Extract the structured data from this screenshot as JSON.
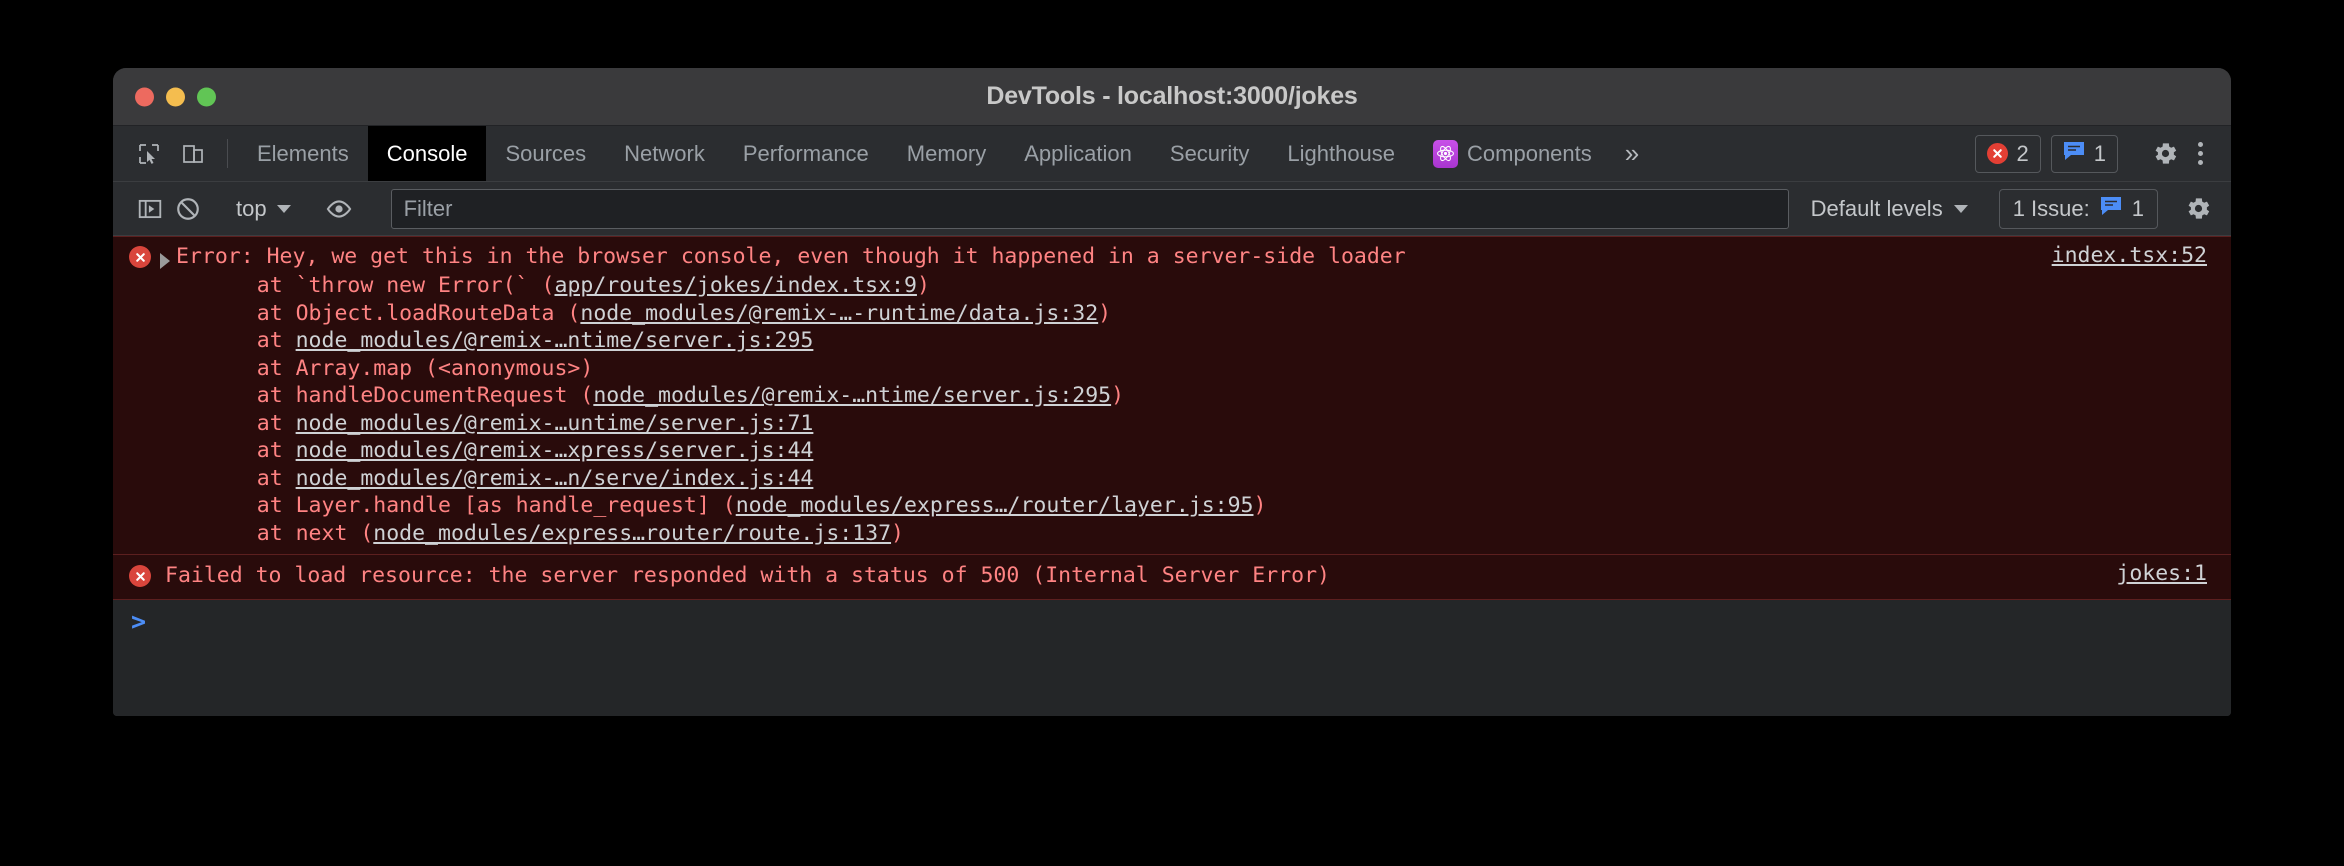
{
  "window": {
    "title": "DevTools - localhost:3000/jokes",
    "traffic_lights": [
      "close",
      "minimize",
      "maximize"
    ]
  },
  "tabbar": {
    "left_icons": [
      "inspect-element-icon",
      "device-toolbar-icon"
    ],
    "tabs": [
      {
        "label": "Elements",
        "active": false
      },
      {
        "label": "Console",
        "active": true
      },
      {
        "label": "Sources",
        "active": false
      },
      {
        "label": "Network",
        "active": false
      },
      {
        "label": "Performance",
        "active": false
      },
      {
        "label": "Memory",
        "active": false
      },
      {
        "label": "Application",
        "active": false
      },
      {
        "label": "Security",
        "active": false
      },
      {
        "label": "Lighthouse",
        "active": false
      },
      {
        "label": "Components",
        "active": false,
        "icon": "react-icon"
      }
    ],
    "more_tabs_label": "»",
    "error_badge": {
      "icon": "error-circle-icon",
      "count": "2"
    },
    "info_badge": {
      "icon": "message-bubble-icon",
      "count": "1"
    },
    "settings_icon": "gear-icon",
    "menu_icon": "kebab-menu-icon"
  },
  "filterbar": {
    "sidebar_toggle_icon": "console-sidebar-icon",
    "clear_icon": "clear-console-icon",
    "context": "top",
    "eye_icon": "live-expression-icon",
    "filter_placeholder": "Filter",
    "filter_value": "",
    "levels": "Default levels",
    "issues": {
      "prefix": "1 Issue:",
      "icon": "message-bubble-icon",
      "count": "1"
    },
    "settings_icon": "gear-icon"
  },
  "console": {
    "messages": [
      {
        "level": "error",
        "expandable": true,
        "text": "Error: Hey, we get this in the browser console, even though it happened in a server-side loader",
        "source": "index.tsx:52",
        "stack": [
          [
            {
              "t": "    at `throw new Error(` (",
              "link": false
            },
            {
              "t": "app/routes/jokes/index.tsx:9",
              "link": true
            },
            {
              "t": ")",
              "link": false
            }
          ],
          [
            {
              "t": "    at Object.loadRouteData (",
              "link": false
            },
            {
              "t": "node_modules/@remix-…-runtime/data.js:32",
              "link": true
            },
            {
              "t": ")",
              "link": false
            }
          ],
          [
            {
              "t": "    at ",
              "link": false
            },
            {
              "t": "node_modules/@remix-…ntime/server.js:295",
              "link": true
            }
          ],
          [
            {
              "t": "    at Array.map (<anonymous>)",
              "link": false
            }
          ],
          [
            {
              "t": "    at handleDocumentRequest (",
              "link": false
            },
            {
              "t": "node_modules/@remix-…ntime/server.js:295",
              "link": true
            },
            {
              "t": ")",
              "link": false
            }
          ],
          [
            {
              "t": "    at ",
              "link": false
            },
            {
              "t": "node_modules/@remix-…untime/server.js:71",
              "link": true
            }
          ],
          [
            {
              "t": "    at ",
              "link": false
            },
            {
              "t": "node_modules/@remix-…xpress/server.js:44",
              "link": true
            }
          ],
          [
            {
              "t": "    at ",
              "link": false
            },
            {
              "t": "node_modules/@remix-…n/serve/index.js:44",
              "link": true
            }
          ],
          [
            {
              "t": "    at Layer.handle [as handle_request] (",
              "link": false
            },
            {
              "t": "node_modules/express…/router/layer.js:95",
              "link": true
            },
            {
              "t": ")",
              "link": false
            }
          ],
          [
            {
              "t": "    at next (",
              "link": false
            },
            {
              "t": "node_modules/express…router/route.js:137",
              "link": true
            },
            {
              "t": ")",
              "link": false
            }
          ]
        ]
      },
      {
        "level": "error",
        "expandable": false,
        "text": "Failed to load resource: the server responded with a status of 500 (Internal Server Error)",
        "source": "jokes:1",
        "stack": []
      }
    ],
    "prompt": ">"
  },
  "colors": {
    "error_red": "#ff8383",
    "error_bg": "#290b0b",
    "error_border": "#5c1f1f",
    "error_icon": "#d9453c",
    "info_blue": "#4c8df6",
    "react_purple": "#b73ad4",
    "console_bg": "#242628",
    "chrome_bg": "#2b2d30",
    "titlebar_bg": "#3a3a3c"
  }
}
